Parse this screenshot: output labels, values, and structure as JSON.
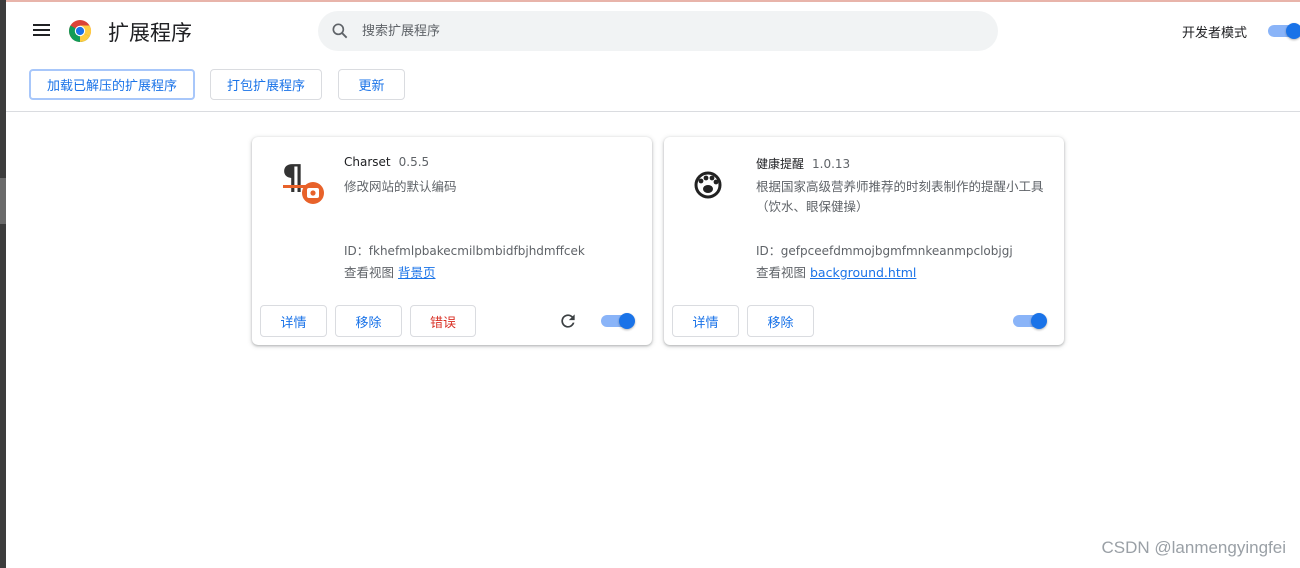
{
  "header": {
    "title": "扩展程序",
    "search_placeholder": "搜索扩展程序",
    "dev_mode_label": "开发者模式",
    "dev_mode_on": true
  },
  "toolbar": {
    "load_unpacked": "加载已解压的扩展程序",
    "pack": "打包扩展程序",
    "update": "更新"
  },
  "extensions": [
    {
      "name": "Charset",
      "version": "0.5.5",
      "description": "修改网站的默认编码",
      "id_text": "ID：fkhefmlpbakecmilbmbidfbjhdmffcek",
      "inspect_label": "查看视图",
      "inspect_link": "背景页",
      "details": "详情",
      "remove": "移除",
      "errors": "错误",
      "enabled": true,
      "icon": "charset-pilcrow-icon"
    },
    {
      "name": "健康提醒",
      "version": "1.0.13",
      "description": "根据国家高级营养师推荐的时刻表制作的提醒小工具（饮水、眼保健操）",
      "id_text": "ID：gefpceefdmmojbgmfmnkeanmpclobjgj",
      "inspect_label": "查看视图",
      "inspect_link": "background.html",
      "details": "详情",
      "remove": "移除",
      "enabled": true,
      "icon": "paw-icon"
    }
  ],
  "watermark": "CSDN @lanmengyingfei",
  "colors": {
    "accent": "#1a73e8",
    "error": "#d93025",
    "toggle_track": "#8ab4f8"
  }
}
